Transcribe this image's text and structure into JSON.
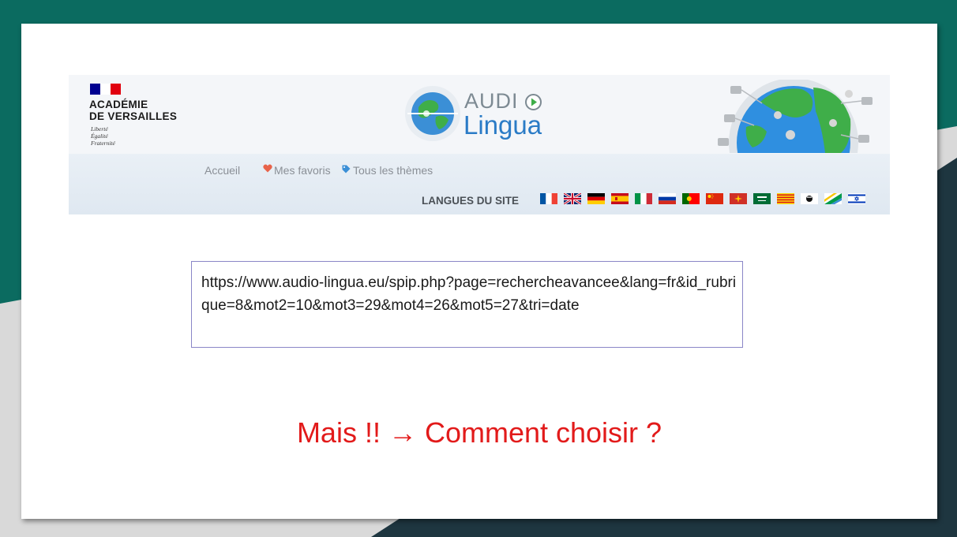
{
  "header": {
    "academie_name": "ACADÉMIE\nDE VERSAILLES",
    "motto": "Liberté\nÉgalité\nFraternité",
    "logo_word1": "AUDI",
    "logo_word2": "Lingua",
    "nav": [
      {
        "label": "Accueil"
      },
      {
        "label": "Mes favoris",
        "icon": "heart-icon"
      },
      {
        "label": "Tous les thèmes",
        "icon": "tag-icon"
      }
    ],
    "languages_label": "LANGUES DU SITE",
    "language_flags": [
      "flag-france-icon",
      "flag-uk-icon",
      "flag-germany-icon",
      "flag-spain-icon",
      "flag-italy-icon",
      "flag-russia-icon",
      "flag-portugal-icon",
      "flag-china-icon",
      "flag-occitan-icon",
      "flag-saudi-arabia-icon",
      "flag-catalonia-icon",
      "flag-corsica-icon",
      "flag-esperanto-icon",
      "flag-israel-icon"
    ]
  },
  "url": "https://www.audio-lingua.eu/spip.php?page=rechercheavancee&lang=fr&id_rubrique=8&mot2=10&mot3=29&mot4=26&mot5=27&tri=date",
  "headline": "Mais !! → Comment choisir ?",
  "colors": {
    "headline": "#e21a1a",
    "lingua_blue": "#2a7bc6",
    "box_border": "#8a86c7",
    "background_teal": "#0b6b60",
    "background_dark": "#1e3640"
  }
}
